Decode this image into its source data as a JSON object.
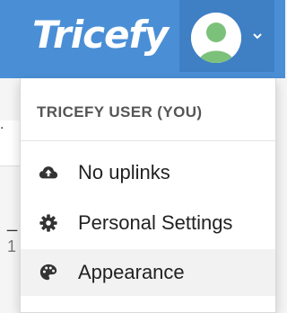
{
  "brand": {
    "logo_text": "Tricefy"
  },
  "colors": {
    "topbar": "#4a8fd6",
    "toggle": "#3f7fc4",
    "avatar": "#7cc17a"
  },
  "user_menu": {
    "header": "TRICEFY USER (YOU)",
    "items": [
      {
        "label": "No uplinks",
        "icon": "cloud-upload-icon"
      },
      {
        "label": "Personal Settings",
        "icon": "gear-icon"
      },
      {
        "label": "Appearance",
        "icon": "palette-icon",
        "highlighted": true
      }
    ]
  }
}
